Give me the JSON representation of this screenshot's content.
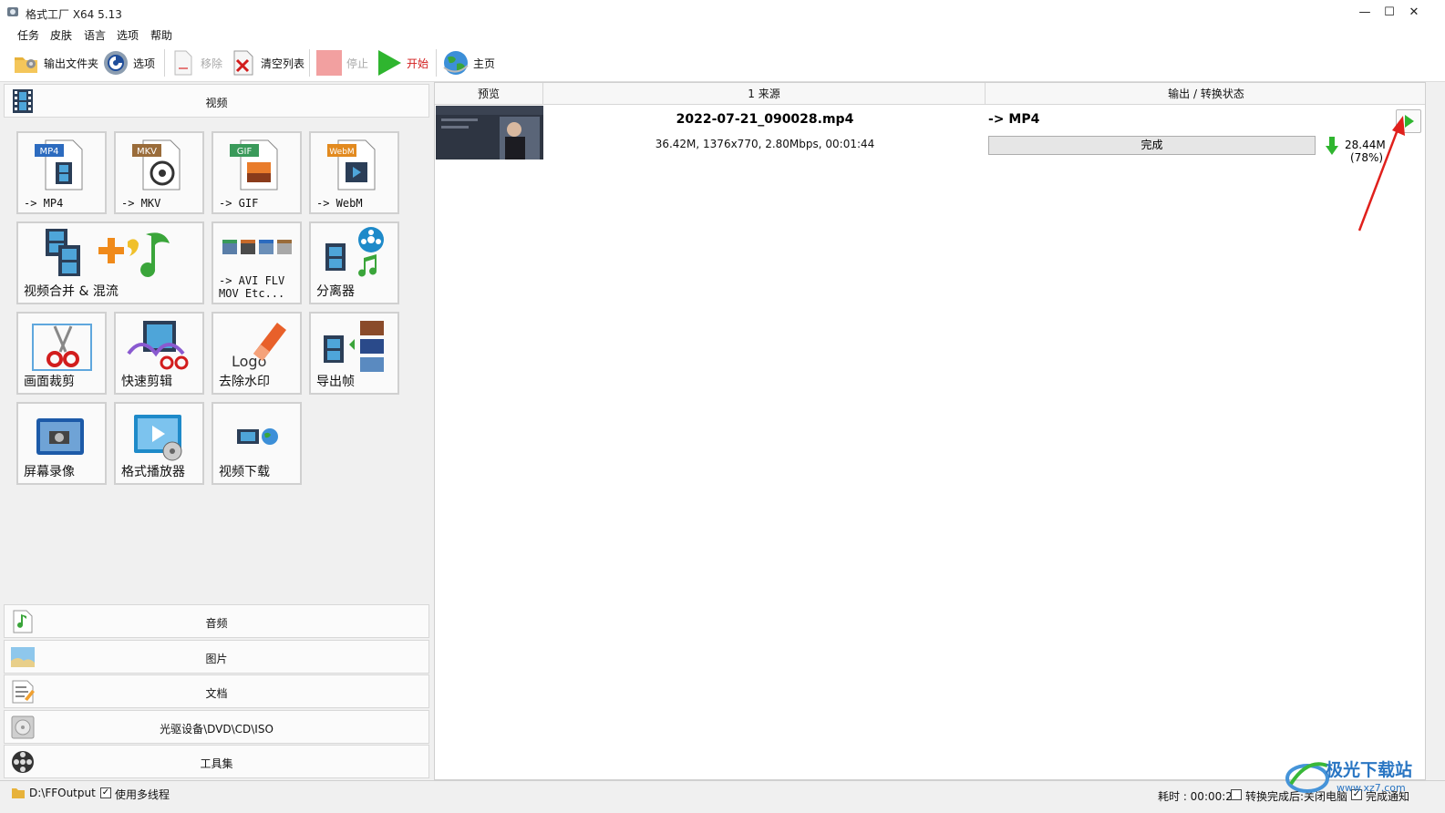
{
  "window": {
    "title": "格式工厂 X64 5.13",
    "minimize": "—",
    "maximize": "☐",
    "close": "✕"
  },
  "menu": {
    "items": [
      "任务",
      "皮肤",
      "语言",
      "选项",
      "帮助"
    ]
  },
  "toolbar": {
    "output_folder": "输出文件夹",
    "options": "选项",
    "remove": "移除",
    "clear_list": "清空列表",
    "stop": "停止",
    "start": "开始",
    "home": "主页"
  },
  "sidebar": {
    "video_header": "视频",
    "tiles": [
      {
        "label": "-> MP4",
        "badge": "MP4"
      },
      {
        "label": "-> MKV",
        "badge": "MKV"
      },
      {
        "label": "-> GIF",
        "badge": "GIF"
      },
      {
        "label": "-> WebM",
        "badge": "WebM"
      },
      {
        "label": "视频合并 & 混流"
      },
      {
        "label": "-> AVI FLV\nMOV Etc..."
      },
      {
        "label": "分离器"
      },
      {
        "label": "画面裁剪"
      },
      {
        "label": "快速剪辑"
      },
      {
        "label": "去除水印",
        "art_text": "Logo"
      },
      {
        "label": "导出帧"
      },
      {
        "label": "屏幕录像"
      },
      {
        "label": "格式播放器"
      },
      {
        "label": "视频下载"
      }
    ],
    "categories": [
      "音频",
      "图片",
      "文档",
      "光驱设备\\DVD\\CD\\ISO",
      "工具集"
    ]
  },
  "tasks": {
    "columns": [
      "预览",
      "1 来源",
      "输出 / 转换状态"
    ],
    "rows": [
      {
        "filename": "2022-07-21_090028.mp4",
        "info": "36.42M, 1376x770, 2.80Mbps, 00:01:44",
        "output_format": "-> MP4",
        "status": "完成",
        "output_size": "28.44M",
        "output_percent": "(78%)"
      }
    ]
  },
  "statusbar": {
    "output_path": "D:\\FFOutput",
    "multithread_label": "使用多线程",
    "multithread_checked": true,
    "elapsed_label": "耗时 : 00:00:26",
    "after_convert_label": "转换完成后:",
    "shutdown_label": "关闭电脑",
    "notify_label": "完成通知",
    "notify_checked": true
  },
  "watermark": {
    "text": "极光下载站",
    "url": "www.xz7.com"
  },
  "colors": {
    "accent_green": "#2fb52f",
    "annotation_red": "#e0201c",
    "stop_red": "#f2a0a0"
  }
}
